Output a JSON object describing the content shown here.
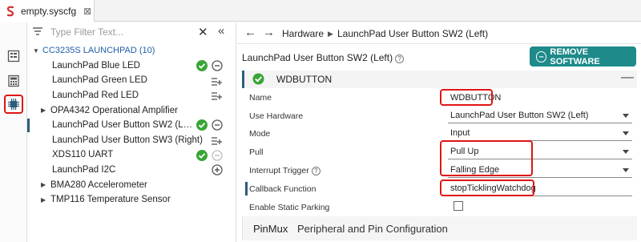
{
  "editor": {
    "tab_label": "empty.syscfg",
    "tab_close": "⊠"
  },
  "activity_bar": {
    "items": [
      {
        "icon": "board-view-icon",
        "active": false
      },
      {
        "icon": "calculator-icon",
        "active": false
      },
      {
        "icon": "chip-icon",
        "active": true
      }
    ]
  },
  "tree": {
    "filter_placeholder": "Type Filter Text...",
    "filter_clear": "✕",
    "filter_collapse": "«",
    "group": {
      "caret": "▼",
      "label": "CC3235S LAUNCHPAD (10)"
    },
    "items": [
      {
        "label": "LaunchPad Blue LED",
        "icons": [
          "check",
          "remove"
        ]
      },
      {
        "label": "LaunchPad Green LED",
        "icons": [
          "add-list"
        ]
      },
      {
        "label": "LaunchPad Red LED",
        "icons": [
          "add-list"
        ]
      },
      {
        "label": "OPA4342 Operational Amplifier",
        "icons": [],
        "expandable": true,
        "caret": "▶"
      },
      {
        "label": "LaunchPad User Button SW2 (Le...",
        "icons": [
          "check",
          "remove"
        ],
        "selected": true
      },
      {
        "label": "LaunchPad User Button SW3 (Right)",
        "icons": [
          "add-list"
        ]
      },
      {
        "label": "XDS110 UART",
        "icons": [
          "check",
          "remove-disabled"
        ]
      },
      {
        "label": "LaunchPad I2C",
        "icons": [
          "add"
        ],
        "indent": true
      },
      {
        "label": "BMA280 Accelerometer",
        "icons": [],
        "expandable": true,
        "caret": "▶"
      },
      {
        "label": "TMP116 Temperature Sensor",
        "icons": [],
        "expandable": true,
        "caret": "▶"
      }
    ]
  },
  "nav": {
    "back": "←",
    "forward": "→",
    "crumb_1": "Hardware",
    "sep": "▶",
    "crumb_2": "LaunchPad User Button SW2 (Left)"
  },
  "panel": {
    "title": "LaunchPad User Button SW2 (Left)",
    "help": "?",
    "remove_button": "REMOVE SOFTWARE"
  },
  "card": {
    "title": "WDBUTTON",
    "collapse": "—",
    "props": [
      {
        "label": "Name",
        "value": "WDBUTTON",
        "kind": "input"
      },
      {
        "label": "Use Hardware",
        "value": "LaunchPad User Button SW2 (Left)",
        "kind": "select"
      },
      {
        "label": "Mode",
        "value": "Input",
        "kind": "select"
      },
      {
        "label": "Pull",
        "value": "Pull Up",
        "kind": "select"
      },
      {
        "label": "Interrupt Trigger",
        "value": "Falling Edge",
        "kind": "select",
        "help": true
      },
      {
        "label": "Callback Function",
        "value": "stopTicklingWatchdog",
        "kind": "input"
      },
      {
        "label": "Enable Static Parking",
        "value": "",
        "kind": "checkbox"
      }
    ]
  },
  "pinmux": {
    "title": "PinMux",
    "subtitle": "Peripheral and Pin Configuration"
  },
  "colors": {
    "accent_teal": "#1e8a8a",
    "check_green": "#3aa537",
    "highlight_red": "#e01515",
    "group_blue": "#1f5fa6"
  }
}
